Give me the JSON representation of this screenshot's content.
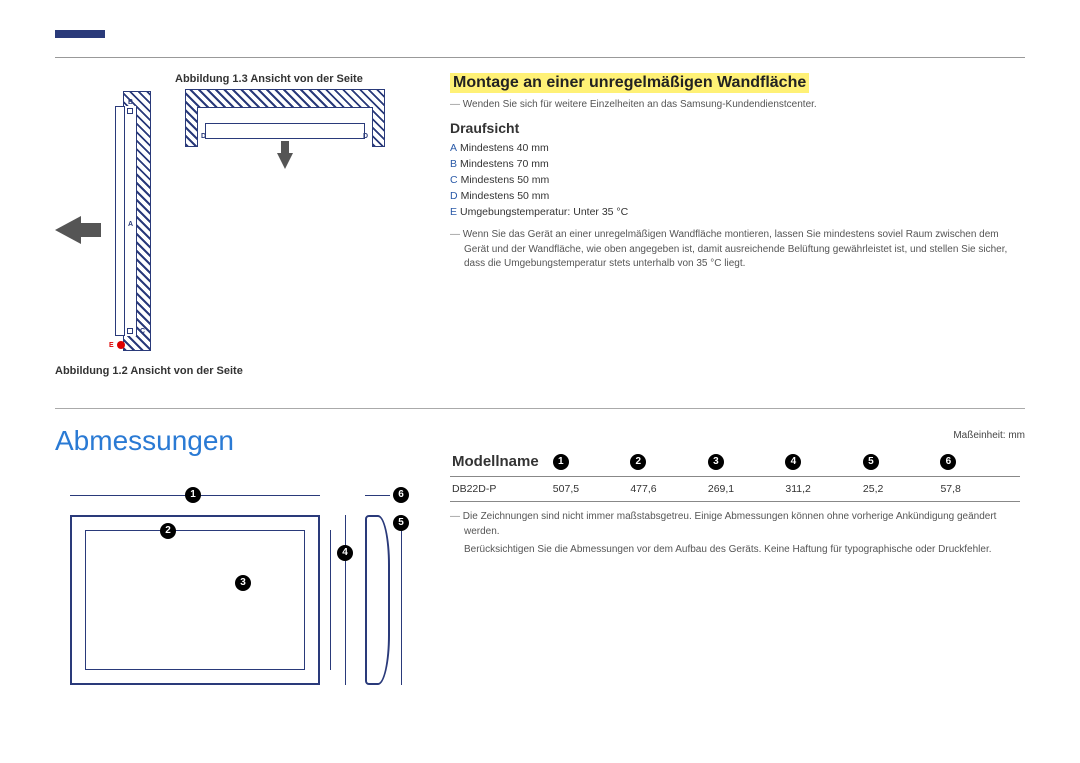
{
  "top_section": {
    "fig13_caption": "Abbildung 1.3 Ansicht von der Seite",
    "fig12_caption": "Abbildung 1.2 Ansicht von der Seite",
    "labels": {
      "A": "A",
      "B": "B",
      "C": "C",
      "D": "D",
      "E": "E"
    }
  },
  "mounting": {
    "title": "Montage an einer unregelmäßigen Wandfläche",
    "contact_note": "Wenden Sie sich für weitere Einzelheiten an das Samsung-Kundendienstcenter.",
    "subheading": "Draufsicht",
    "specs": [
      {
        "key": "A",
        "text": "Mindestens 40 mm"
      },
      {
        "key": "B",
        "text": "Mindestens 70 mm"
      },
      {
        "key": "C",
        "text": "Mindestens 50 mm"
      },
      {
        "key": "D",
        "text": "Mindestens 50 mm"
      },
      {
        "key": "E",
        "text": "Umgebungstemperatur: Unter 35 °C"
      }
    ],
    "paragraph": "Wenn Sie das Gerät an einer unregelmäßigen Wandfläche montieren, lassen Sie mindestens soviel Raum zwischen dem Gerät und der Wandfläche, wie oben angegeben ist, damit ausreichende Belüftung gewährleistet ist, und stellen Sie sicher, dass die Umgebungstemperatur stets unterhalb von 35 °C liegt."
  },
  "dimensions": {
    "title": "Abmessungen",
    "unit": "Maßeinheit: mm",
    "headers": {
      "model": "Modellname",
      "c1": "1",
      "c2": "2",
      "c3": "3",
      "c4": "4",
      "c5": "5",
      "c6": "6"
    },
    "row": {
      "model": "DB22D-P",
      "v1": "507,5",
      "v2": "477,6",
      "v3": "269,1",
      "v4": "311,2",
      "v5": "25,2",
      "v6": "57,8"
    },
    "note1": "Die Zeichnungen sind nicht immer maßstabsgetreu. Einige Abmessungen können ohne vorherige Ankündigung geändert werden.",
    "note2": "Berücksichtigen Sie die Abmessungen vor dem Aufbau des Geräts. Keine Haftung für typographische oder Druckfehler."
  },
  "markers": {
    "m1": "1",
    "m2": "2",
    "m3": "3",
    "m4": "4",
    "m5": "5",
    "m6": "6"
  }
}
